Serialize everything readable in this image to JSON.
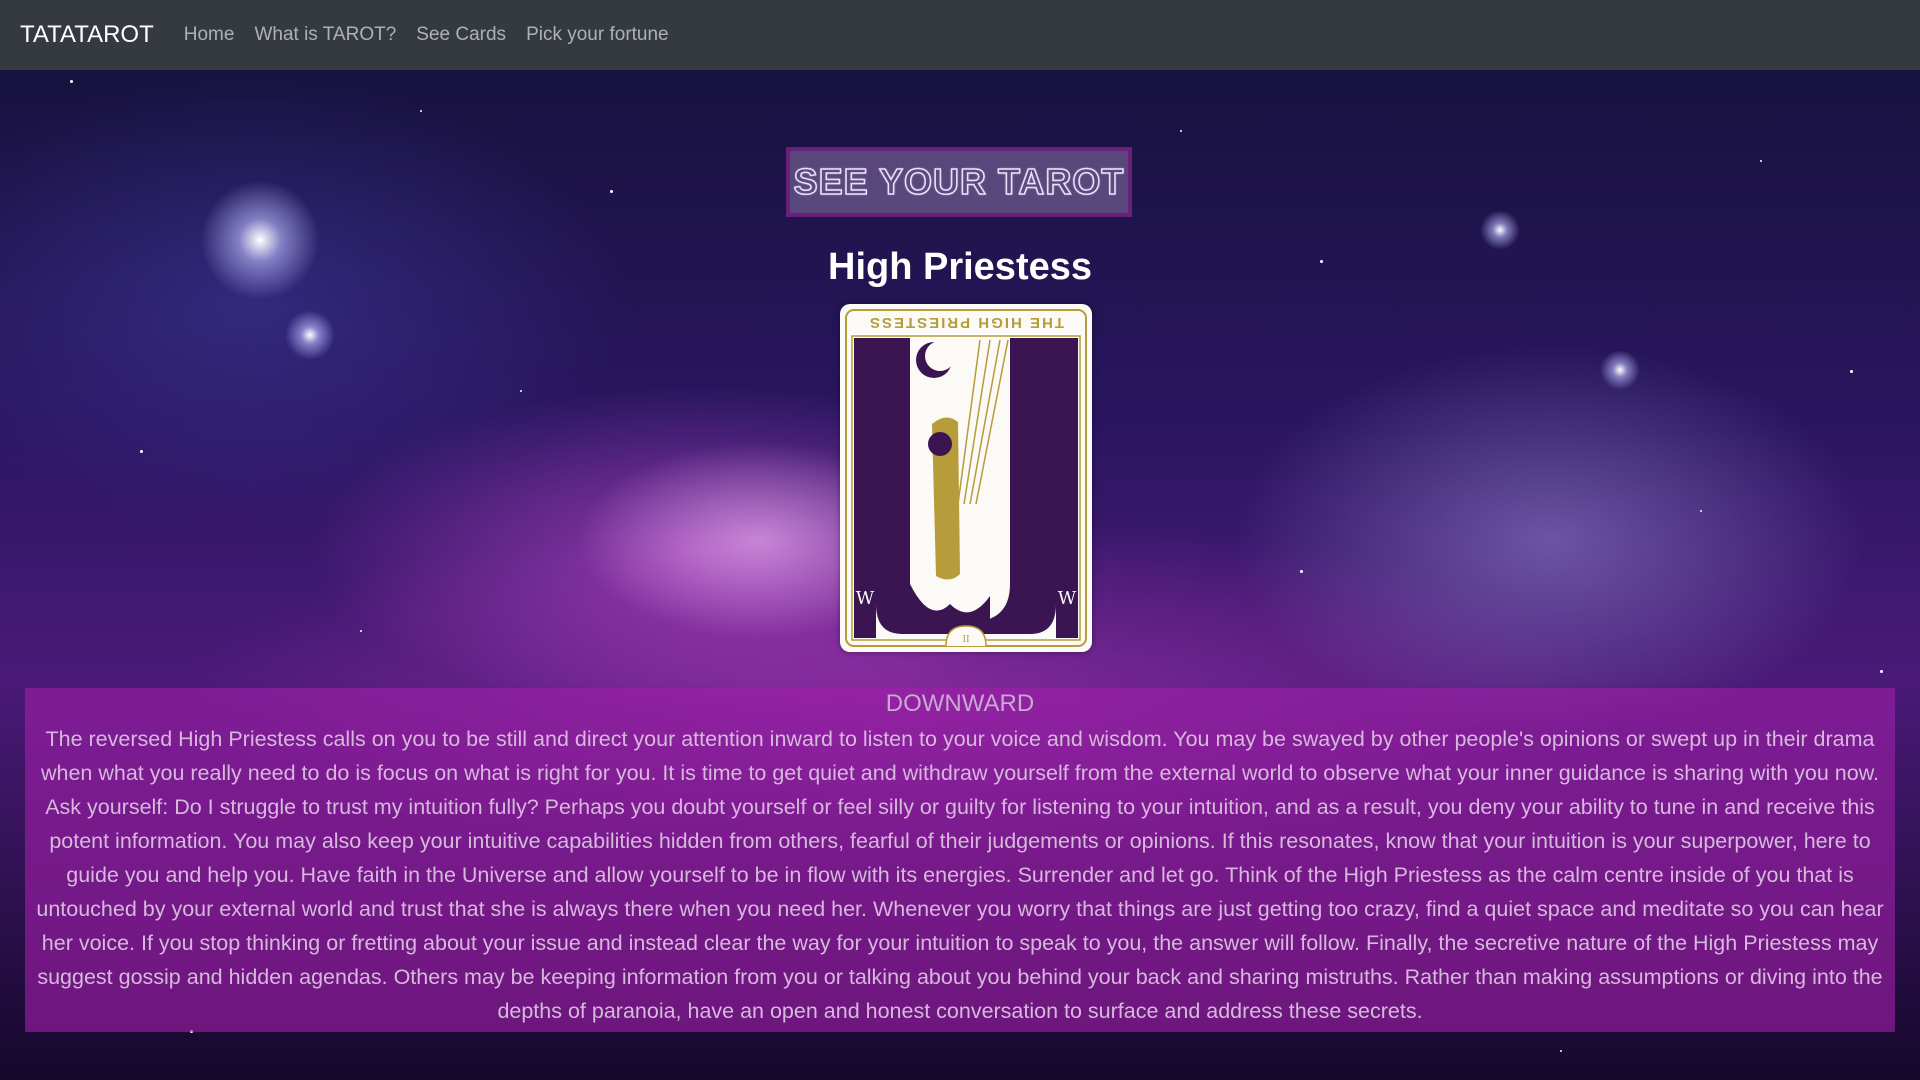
{
  "navbar": {
    "brand": "TATATAROT",
    "links": [
      "Home",
      "What is TAROT?",
      "See Cards",
      "Pick your fortune"
    ]
  },
  "hero": {
    "banner_label": "SEE YOUR TAROT"
  },
  "card": {
    "name": "High Priestess",
    "card_label": "THE HIGH PRIESTESS",
    "numeral": "II",
    "orientation": "reversed"
  },
  "reading": {
    "title": "DOWNWARD",
    "body": "The reversed High Priestess calls on you to be still and direct your attention inward to listen to your voice and wisdom. You may be swayed by other people's opinions or swept up in their drama when what you really need to do is focus on what is right for you. It is time to get quiet and withdraw yourself from the external world to observe what your inner guidance is sharing with you now. Ask yourself: Do I struggle to trust my intuition fully? Perhaps you doubt yourself or feel silly or guilty for listening to your intuition, and as a result, you deny your ability to tune in and receive this potent information. You may also keep your intuitive capabilities hidden from others, fearful of their judgements or opinions. If this resonates, know that your intuition is your superpower, here to guide you and help you. Have faith in the Universe and allow yourself to be in flow with its energies. Surrender and let go. Think of the High Priestess as the calm centre inside of you that is untouched by your external world and trust that she is always there when you need her. Whenever you worry that things are just getting too crazy, find a quiet space and meditate so you can hear her voice. If you stop thinking or fretting about your issue and instead clear the way for your intuition to speak to you, the answer will follow. Finally, the secretive nature of the High Priestess may suggest gossip and hidden agendas. Others may be keeping information from you or talking about you behind your back and sharing mistruths. Rather than making assumptions or diving into the depths of paranoia, have an open and honest conversation to surface and address these secrets."
  },
  "colors": {
    "navbar_bg": "#343a40",
    "card_purple": "#3b1552",
    "card_gold": "#b69c3a",
    "panel_magenta": "#a01eaa"
  }
}
